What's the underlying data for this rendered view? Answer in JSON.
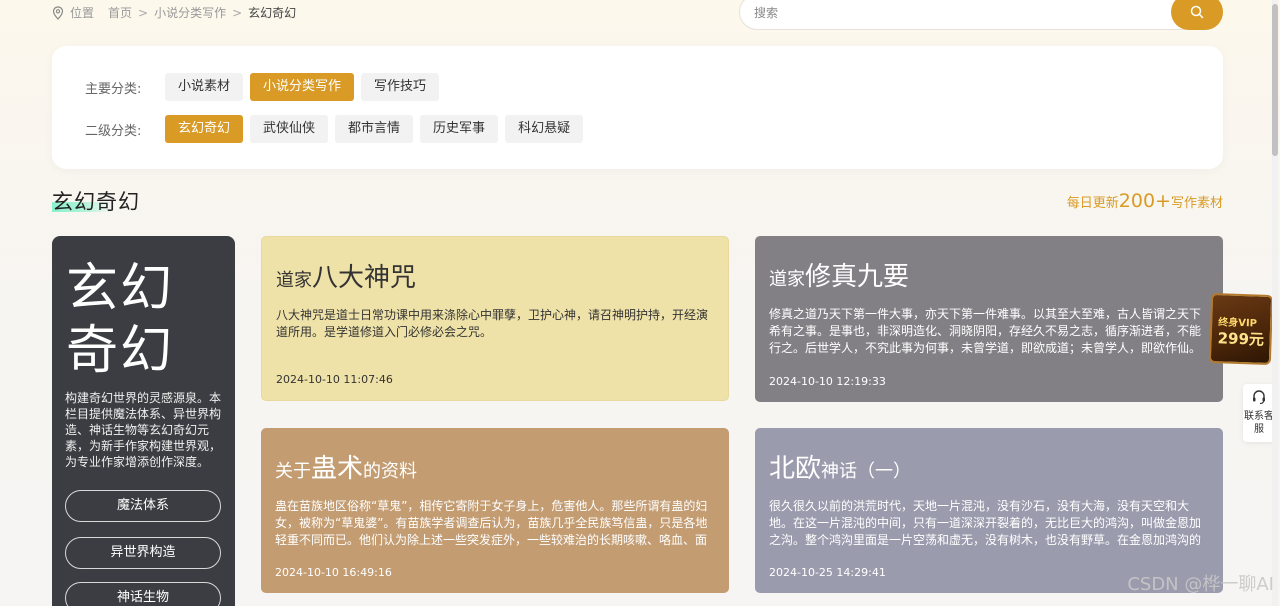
{
  "breadcrumb": {
    "location": "位置",
    "items": [
      "首页",
      "小说分类写作",
      "玄幻奇幻"
    ],
    "separator": ">"
  },
  "search": {
    "placeholder": "搜索",
    "value": ""
  },
  "filters": {
    "primary_label": "主要分类:",
    "primary": [
      "小说素材",
      "小说分类写作",
      "写作技巧"
    ],
    "primary_active": "小说分类写作",
    "secondary_label": "二级分类:",
    "secondary": [
      "玄幻奇幻",
      "武侠仙侠",
      "都市言情",
      "历史军事",
      "科幻悬疑"
    ],
    "secondary_active": "玄幻奇幻"
  },
  "section": {
    "title": "玄幻奇幻",
    "update_prefix": "每日更新",
    "update_number": "200+",
    "update_suffix": "写作素材"
  },
  "category_card": {
    "title_line1": "玄幻",
    "title_line2": "奇幻",
    "description": "构建奇幻世界的灵感源泉。本栏目提供魔法体系、异世界构造、神话生物等玄幻奇幻元素，为新手作家构建世界观，为专业作家增添创作深度。",
    "buttons": [
      "魔法体系",
      "异世界构造",
      "神话生物"
    ]
  },
  "articles": [
    {
      "title_prefix": "道家",
      "title_emphasis": "八大神咒",
      "title_suffix": "",
      "description": "八大神咒是道士日常功课中用来涤除心中罪孽，卫护心神，请召神明护持，开经演道所用。是学道修道入门必修必会之咒。",
      "date": "2024-10-10 11:07:46"
    },
    {
      "title_prefix": "道家",
      "title_emphasis": "修真九要",
      "title_suffix": "",
      "description": "修真之道乃天下第一件大事，亦天下第一件难事。以其至大至难，古人皆谓之天下希有之事。是事也，非深明造化、洞晓阴阳，存经久不易之志，循序渐进者，不能行之。后世学人，不究此事为何事，未曾学道，即欲成道；未曾学人，即欲作仙。无...",
      "date": "2024-10-10 12:19:33"
    },
    {
      "title_prefix": "关于",
      "title_emphasis": "蛊术",
      "title_suffix": "的资料",
      "description": "蛊在苗族地区俗称“草鬼”，相传它寄附于女子身上，危害他人。那些所谓有蛊的妇女，被称为“草鬼婆”。有苗族学者调查后认为，苗族几乎全民族笃信蛊，只是各地轻重不同而已。他们认为除上述一些突发症外，一些较难治的长期咳嗽、咯血、面色...",
      "date": "2024-10-10 16:49:16"
    },
    {
      "title_prefix": "",
      "title_emphasis": "北欧",
      "title_suffix": "神话（一）",
      "description": "很久很久以前的洪荒时代，天地一片混沌，没有沙石，没有大海，没有天空和大地。在这一片混沌的中间，只有一道深深开裂着的，无比巨大的鸿沟，叫做金恩加之沟。整个鸿沟里面是一片空荡和虚无，没有树木，也没有野草。在金恩加鸿沟的北方，...",
      "date": "2024-10-25 14:29:41"
    }
  ],
  "vip_badge": {
    "line1": "终身VIP",
    "line2": "299元"
  },
  "contact": {
    "label": "联系客服"
  },
  "watermark": "CSDN @桦一聊AI",
  "colors": {
    "accent": "#d99b25",
    "card_dark": "#3c3d42"
  },
  "icons": {
    "location": "location-pin-icon",
    "search": "search-icon",
    "headset": "headset-icon"
  }
}
